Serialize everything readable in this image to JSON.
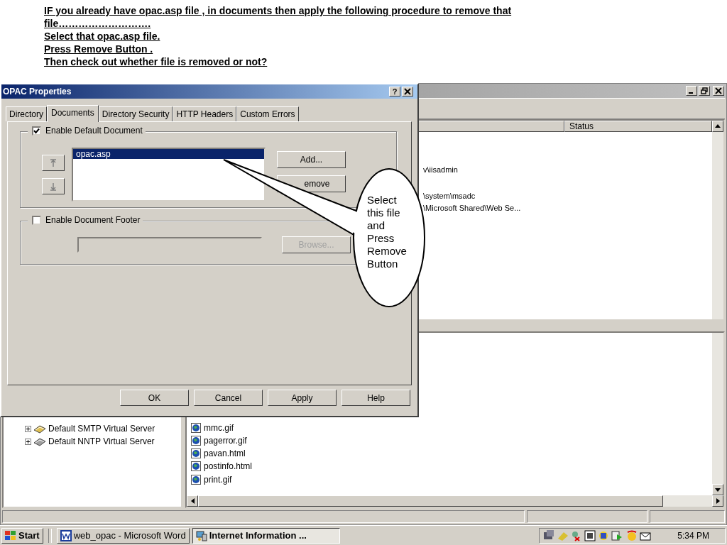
{
  "slide_notes": [
    "IF you already have opac.asp file , in documents then apply the following procedure to remove that file……………………….",
    "Select that opac.asp file.",
    "Press Remove Button .",
    "Then check out whether file is removed or not?"
  ],
  "main_window": {
    "column_header": "Status",
    "paths": [
      "v\\iisadmin",
      "\\system\\msadc",
      "\\Microsoft Shared\\Web Se..."
    ],
    "tree_items": [
      {
        "label": "Default SMTP Virtual Server",
        "expanded": false
      },
      {
        "label": "Default NNTP Virtual Server",
        "expanded": false
      }
    ],
    "files": [
      "mmc.gif",
      "pagerror.gif",
      "pavan.html",
      "postinfo.html",
      "print.gif"
    ]
  },
  "dialog": {
    "title": "OPAC Properties",
    "help": "?",
    "tabs": [
      {
        "label": "Directory",
        "selected": false
      },
      {
        "label": "Documents",
        "selected": true
      },
      {
        "label": "Directory Security",
        "selected": false
      },
      {
        "label": "HTTP Headers",
        "selected": false
      },
      {
        "label": "Custom Errors",
        "selected": false
      }
    ],
    "default_document": {
      "label": "Enable Default Document",
      "checked": true,
      "documents": [
        {
          "name": "opac.asp",
          "selected": true
        }
      ],
      "buttons": [
        {
          "label": "Add...",
          "disabled": false
        },
        {
          "label": "emove",
          "disabled": false
        }
      ]
    },
    "footer": {
      "label": "Enable Document Footer",
      "checked": false,
      "browse": {
        "label": "Browse...",
        "disabled": true
      }
    },
    "buttons": [
      "OK",
      "Cancel",
      "Apply",
      "Help"
    ]
  },
  "callout": {
    "text": "Select this file and Press Remove Button"
  },
  "taskbar": {
    "start": "Start",
    "tasks": [
      {
        "label": "web_opac - Microsoft Word",
        "selected": false
      },
      {
        "label": "Internet Information ...",
        "selected": true
      }
    ],
    "clock": "5:34 PM"
  }
}
